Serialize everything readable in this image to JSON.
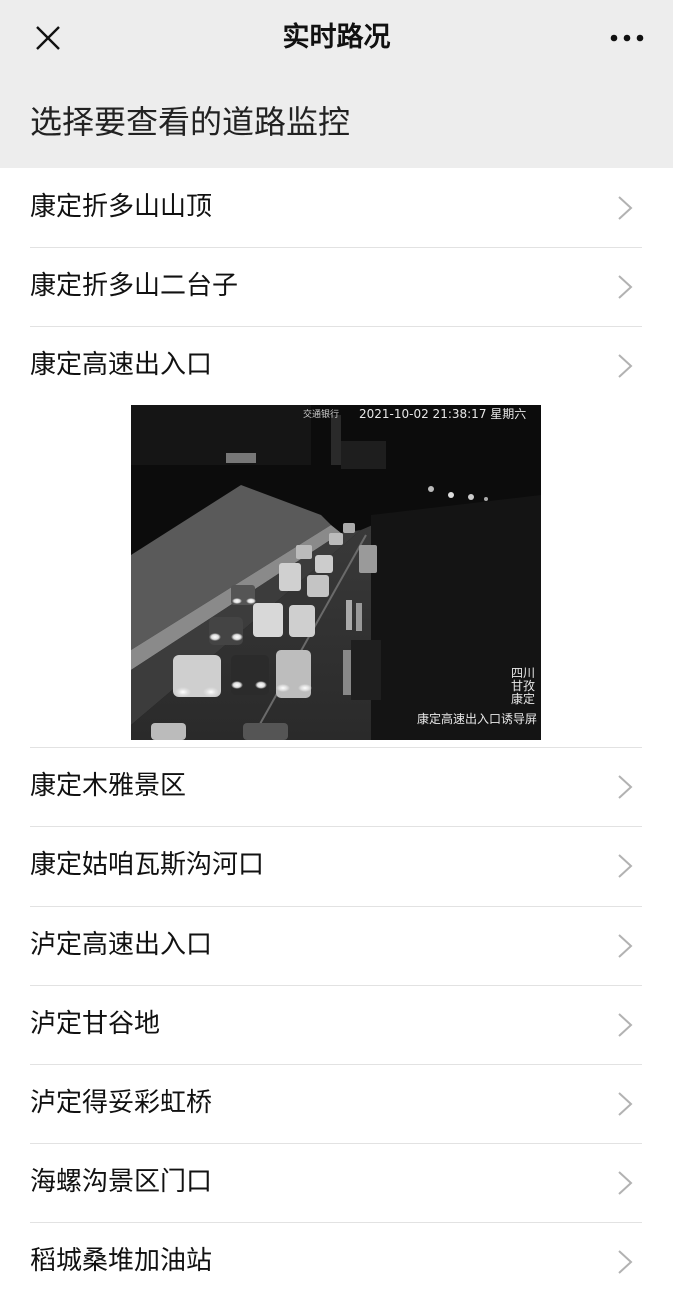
{
  "header": {
    "title": "实时路况",
    "close_icon": "close-icon",
    "more_icon": "more-dots-icon"
  },
  "subheader": {
    "text": "选择要查看的道路监控"
  },
  "roads": [
    {
      "label": "康定折多山山顶"
    },
    {
      "label": "康定折多山二台子"
    },
    {
      "label": "康定高速出入口"
    },
    {
      "label": "康定木雅景区"
    },
    {
      "label": "康定姑咱瓦斯沟河口"
    },
    {
      "label": "泸定高速出入口"
    },
    {
      "label": "泸定甘谷地"
    },
    {
      "label": "泸定得妥彩虹桥"
    },
    {
      "label": "海螺沟景区门口"
    },
    {
      "label": "稻城桑堆加油站"
    }
  ],
  "camera": {
    "timestamp": "2021-10-02 21:38:17 星期六",
    "logo_text": "交通银行",
    "region_lines": [
      "四川",
      "甘孜",
      "康定"
    ],
    "caption": "康定高速出入口诱导屏"
  },
  "colors": {
    "bar_background": "#ededed",
    "divider": "#e2e2e2",
    "chevron": "#b2b2b2"
  }
}
